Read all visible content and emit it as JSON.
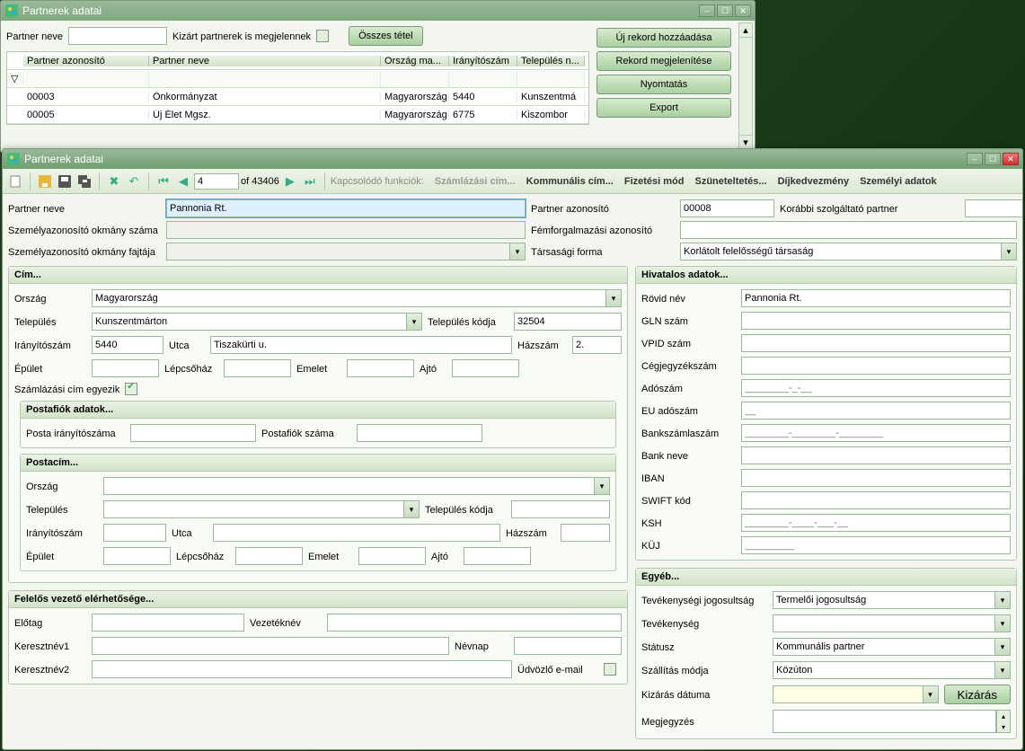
{
  "window1": {
    "title": "Partnerek adatai",
    "filter": {
      "partner_neve_label": "Partner neve",
      "kizart_label": "Kizárt partnerek is megjelennek",
      "osszes_tetel": "Összes tétel"
    },
    "buttons": {
      "uj_rekord": "Új rekord hozzáadása",
      "rekord_megj": "Rekord megjelenítése",
      "nyomtatas": "Nyomtatás",
      "export": "Export"
    },
    "grid": {
      "headers": {
        "azon": "Partner azonosító",
        "nev": "Partner neve",
        "orszag": "Ország ma...",
        "irsz": "Irányítószám",
        "telepules": "Település n..."
      },
      "rows": [
        {
          "azon": "00003",
          "nev": "Önkormányzat",
          "orszag": "Magyarország",
          "irsz": "5440",
          "telepules": "Kunszentmá"
        },
        {
          "azon": "00005",
          "nev": "Új Élet Mgsz.",
          "orszag": "Magyarország",
          "irsz": "6775",
          "telepules": "Kiszombor"
        }
      ]
    }
  },
  "window2": {
    "title": "Partnerek adatai",
    "toolbar": {
      "nav_pos": "4",
      "nav_total": "of 43406",
      "kapcsolodo": "Kapcsolódó funkciók:",
      "links": {
        "szamlazasi": "Számlázási cím...",
        "kommunalis": "Kommunális cím...",
        "fizetesi": "Fizetési mód",
        "szunetelt": "Szüneteltetés...",
        "dijkedv": "Díjkedvezmény",
        "szemelyi": "Személyi adatok"
      }
    },
    "top": {
      "partner_neve_lbl": "Partner neve",
      "partner_neve_val": "Pannonia Rt.",
      "partner_azon_lbl": "Partner azonosító",
      "partner_azon_val": "00008",
      "korabbi_lbl": "Korábbi szolgáltató partner",
      "szemokm_szam_lbl": "Személyazonosító okmány száma",
      "femforg_lbl": "Fémforgalmazási azonosító",
      "szemokm_fajta_lbl": "Személyazonosító okmány fajtája",
      "tarsasagi_lbl": "Társasági forma",
      "tarsasagi_val": "Korlátolt felelősségű társaság"
    },
    "cim": {
      "title": "Cím...",
      "orszag_lbl": "Ország",
      "orszag_val": "Magyarország",
      "telepules_lbl": "Település",
      "telepules_val": "Kunszentmárton",
      "telepules_kod_lbl": "Település kódja",
      "telepules_kod_val": "32504",
      "irsz_lbl": "Irányítószám",
      "irsz_val": "5440",
      "utca_lbl": "Utca",
      "utca_val": "Tiszakürti u.",
      "hazszam_lbl": "Házszám",
      "hazszam_val": "2.",
      "epulet_lbl": "Épület",
      "lepcso_lbl": "Lépcsőház",
      "emelet_lbl": "Emelet",
      "ajto_lbl": "Ajtó",
      "szamlazasi_egyezik_lbl": "Számlázási cím egyezik",
      "postafiok_title": "Postafiók adatok...",
      "posta_irsz_lbl": "Posta irányítószáma",
      "postafiok_szam_lbl": "Postafiók száma",
      "postacim_title": "Postacím..."
    },
    "felelos": {
      "title": "Felelős vezető elérhetősége...",
      "elotag_lbl": "Előtag",
      "vezeteknev_lbl": "Vezetéknév",
      "keresztnev1_lbl": "Keresztnév1",
      "nevnap_lbl": "Névnap",
      "keresztnev2_lbl": "Keresztnév2",
      "udv_email_lbl": "Üdvözlő e-mail"
    },
    "hivatalos": {
      "title": "Hivatalos adatok...",
      "rovid_nev_lbl": "Rövid név",
      "rovid_nev_val": "Pannonia Rt.",
      "gln_lbl": "GLN szám",
      "vpid_lbl": "VPID szám",
      "cegjegyzek_lbl": "Cégjegyzékszám",
      "adoszam_lbl": "Adószám",
      "adoszam_ph": "________-_-__",
      "eu_ado_lbl": "EU adószám",
      "eu_ado_ph": "__",
      "bankszamla_lbl": "Bankszámlaszám",
      "bankszamla_ph": "________-________-________",
      "banknev_lbl": "Bank neve",
      "iban_lbl": "IBAN",
      "swift_lbl": "SWIFT kód",
      "ksh_lbl": "KSH",
      "ksh_ph": "________-____-___-__",
      "kuj_lbl": "KÜJ",
      "kuj_ph": "_________"
    },
    "egyeb": {
      "title": "Egyéb...",
      "tevjog_lbl": "Tevékenységi jogosultság",
      "tevjog_val": "Termelői jogosultság",
      "tevekenyseg_lbl": "Tevékenység",
      "statusz_lbl": "Státusz",
      "statusz_val": "Kommunális partner",
      "szallitas_lbl": "Szállítás módja",
      "szallitas_val": "Közúton",
      "kizaras_datum_lbl": "Kizárás dátuma",
      "kizaras_btn": "Kizárás",
      "megjegyzes_lbl": "Megjegyzés"
    }
  }
}
